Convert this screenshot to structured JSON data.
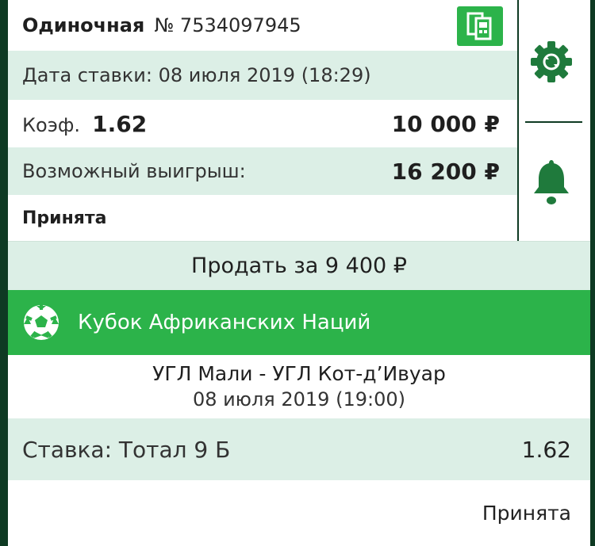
{
  "header": {
    "type_label": "Одиночная",
    "number": "№ 7534097945"
  },
  "bet_date": "Дата ставки: 08 июля 2019 (18:29)",
  "coef": {
    "label": "Коэф.",
    "value": "1.62",
    "stake": "10 000 ₽"
  },
  "payout": {
    "label": "Возможный выигрыш:",
    "value": "16 200 ₽"
  },
  "status": "Принята",
  "sell_button": "Продать за 9 400 ₽",
  "league": {
    "name": "Кубок Африканских Наций"
  },
  "match": {
    "teams": "УГЛ Мали - УГЛ Кот-д’Ивуар",
    "date": "08 июля 2019 (19:00)"
  },
  "selection": {
    "label": "Ставка: Тотал 9 Б",
    "coef": "1.62"
  },
  "selection_status": "Принята",
  "colors": {
    "accent_green": "#2cb34a",
    "dark_green": "#0e3a23",
    "mint": "#dcefe6"
  },
  "icons": [
    "copy-icon",
    "gear-icon",
    "bell-icon",
    "soccer-ball-icon"
  ]
}
